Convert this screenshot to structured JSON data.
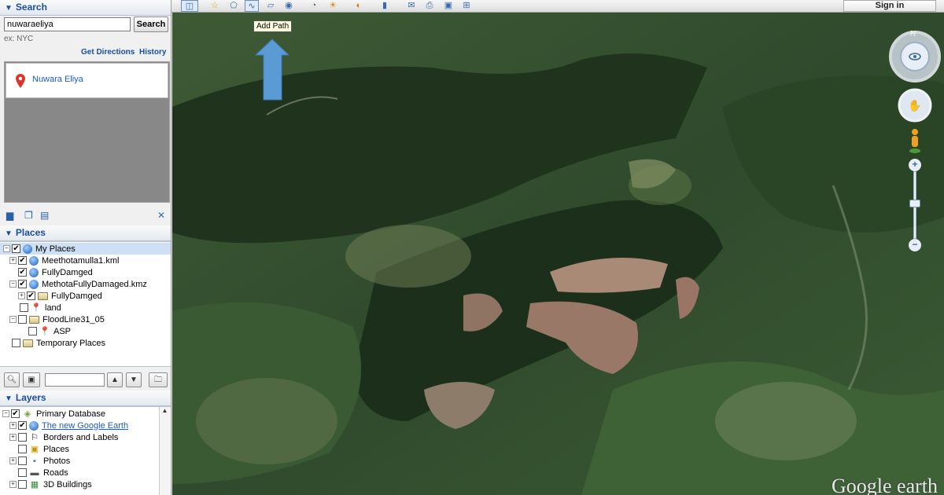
{
  "search": {
    "header": "Search",
    "query": "nuwaraeliya",
    "button": "Search",
    "hint": "ex: NYC",
    "get_directions": "Get Directions",
    "history": "History",
    "result": "Nuwara Eliya"
  },
  "places": {
    "header": "Places",
    "items": [
      {
        "label": "My Places",
        "checked": true,
        "icon": "globe-icon"
      },
      {
        "label": "Meethotamulla1.kml",
        "checked": true,
        "icon": "globe-icon"
      },
      {
        "label": "FullyDamged",
        "checked": true,
        "icon": "globe-icon"
      },
      {
        "label": "MethotaFullyDamaged.kmz",
        "checked": true,
        "icon": "globe-icon"
      },
      {
        "label": "FullyDamged",
        "checked": true,
        "icon": "folder-icon"
      },
      {
        "label": "land",
        "checked": false,
        "icon": "pushpin-icon"
      },
      {
        "label": "FloodLine31_05",
        "checked": false,
        "icon": "folder-icon"
      },
      {
        "label": "ASP",
        "checked": false,
        "icon": "pushpin-icon"
      },
      {
        "label": "Temporary Places",
        "checked": false,
        "icon": "folder-icon"
      }
    ]
  },
  "layers": {
    "header": "Layers",
    "items": [
      {
        "label": "Primary Database",
        "checked": true
      },
      {
        "label": "The new Google Earth",
        "checked": true
      },
      {
        "label": "Borders and Labels",
        "checked": false
      },
      {
        "label": "Places",
        "checked": false
      },
      {
        "label": "Photos",
        "checked": false
      },
      {
        "label": "Roads",
        "checked": false
      },
      {
        "label": "3D Buildings",
        "checked": false
      }
    ]
  },
  "toolbar": {
    "tooltip": "Add Path",
    "sign_in": "Sign in"
  },
  "map": {
    "compass_north": "N",
    "brand": "Google earth"
  },
  "colors": {
    "header_text": "#1a4fa0",
    "link": "#1a5cc8",
    "arrow": "#5b9bd5"
  }
}
